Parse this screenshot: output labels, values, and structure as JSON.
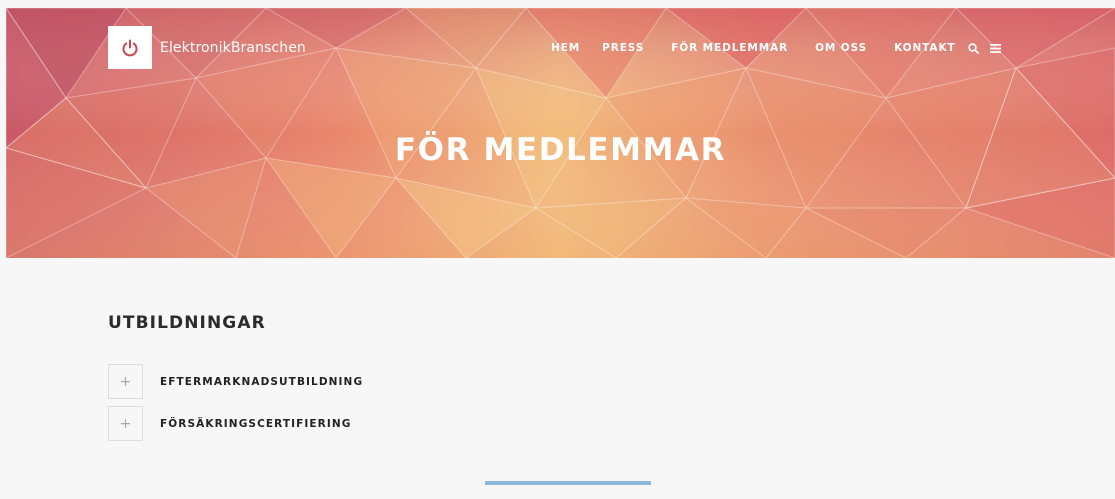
{
  "brand": {
    "name": "ElektronikBranschen",
    "logo_icon": "power-icon"
  },
  "nav": {
    "items": [
      {
        "label": "HEM"
      },
      {
        "label": "PRESS"
      },
      {
        "label": "FÖR MEDLEMMAR"
      },
      {
        "label": "OM OSS"
      },
      {
        "label": "KONTAKT"
      }
    ],
    "search_icon": "search-icon",
    "menu_icon": "hamburger-menu-icon"
  },
  "hero": {
    "title": "FÖR MEDLEMMAR"
  },
  "main": {
    "section_title": "UTBILDNINGAR",
    "accordion": [
      {
        "toggle": "+",
        "label": "EFTERMARKNADSUTBILDNING"
      },
      {
        "toggle": "+",
        "label": "FÖRSÄKRINGSCERTIFIERING"
      }
    ]
  },
  "colors": {
    "hero_warm": "#e8806a",
    "hero_gold": "#f2c07a",
    "hero_red": "#dc4f5a",
    "accent_bar": "#8fb7d8",
    "page_bg": "#f7f7f7"
  }
}
